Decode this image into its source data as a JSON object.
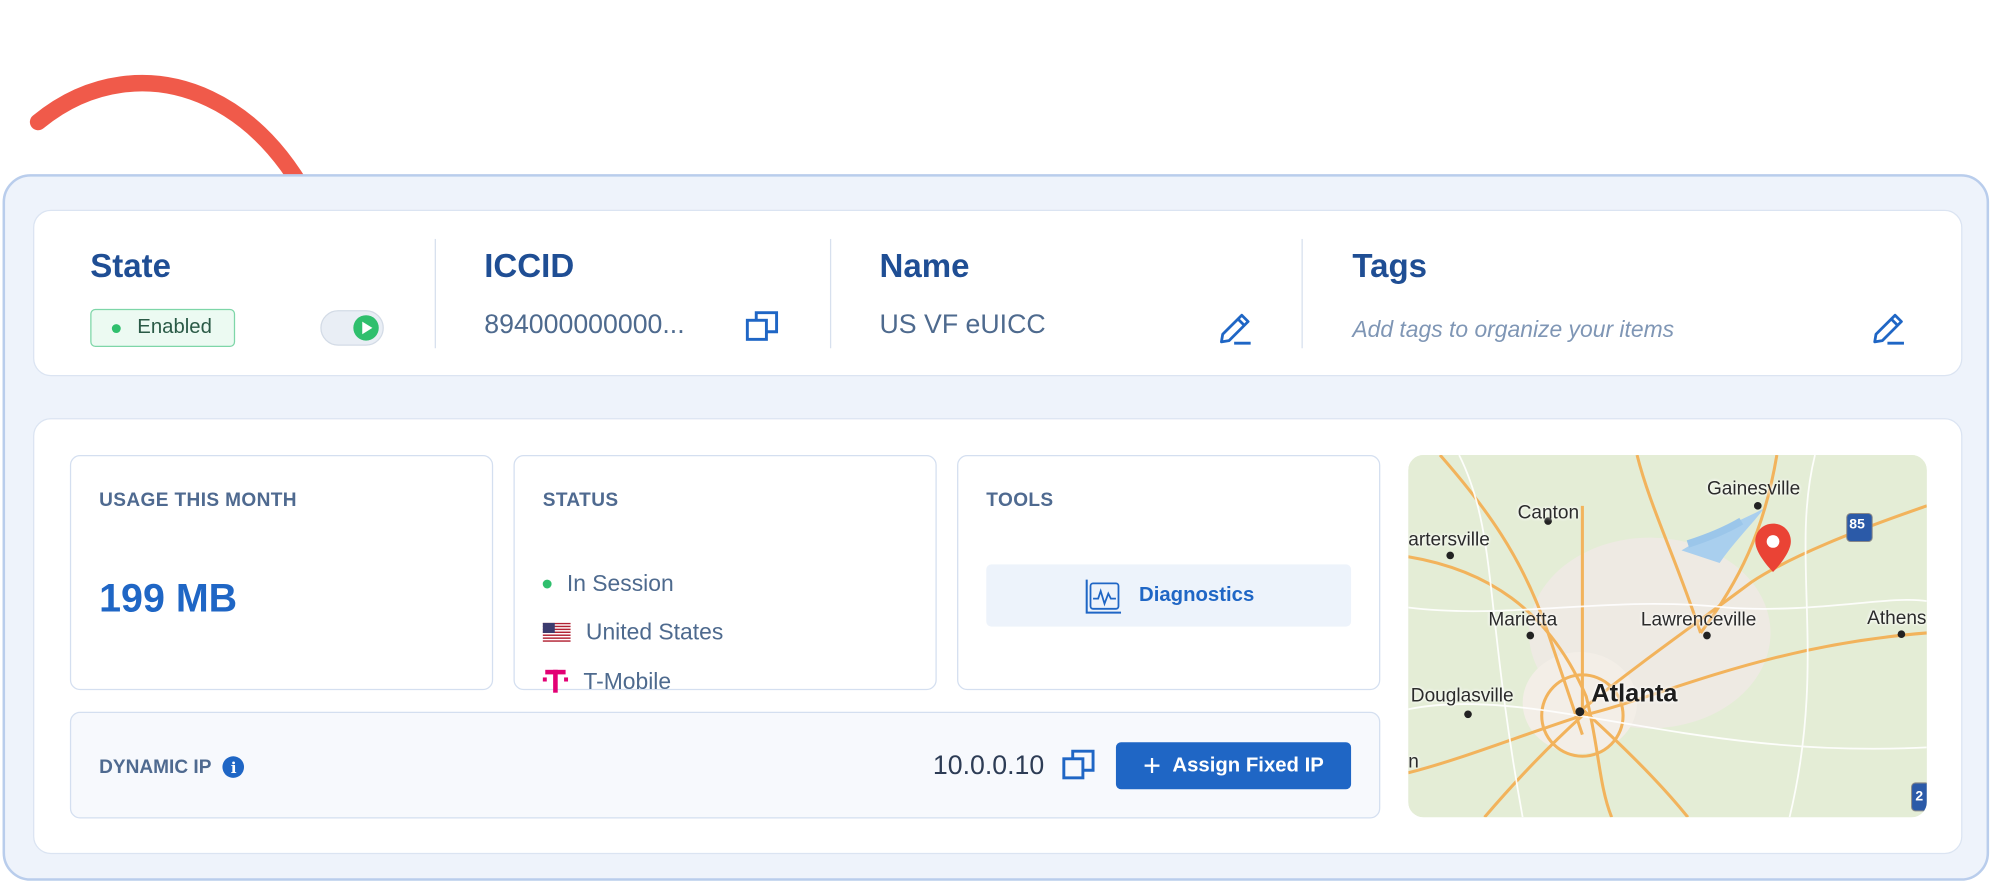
{
  "header": {
    "state": {
      "title": "State",
      "badge": "Enabled"
    },
    "iccid": {
      "title": "ICCID",
      "value": "894000000000..."
    },
    "name": {
      "title": "Name",
      "value": "US VF eUICC"
    },
    "tags": {
      "title": "Tags",
      "placeholder": "Add tags to organize your items"
    }
  },
  "usage": {
    "label": "USAGE THIS MONTH",
    "value": "199 MB"
  },
  "status": {
    "label": "STATUS",
    "session": "In Session",
    "country": "United States",
    "carrier": "T-Mobile"
  },
  "tools": {
    "label": "TOOLS",
    "diagnostics": "Diagnostics"
  },
  "ip": {
    "label": "DYNAMIC IP",
    "info": "i",
    "value": "10.0.0.10",
    "assign_label": "Assign Fixed IP",
    "assign_plus": "+"
  },
  "map": {
    "labels": {
      "gainesville": "Gainesville",
      "canton": "Canton",
      "cartersville": "artersville",
      "marietta": "Marietta",
      "lawrenceville": "Lawrenceville",
      "athens": "Athens",
      "douglasville": "Douglasville",
      "atlanta": "Atlanta",
      "edge_n": "n",
      "interstate": "85",
      "interstate2": "2"
    }
  },
  "colors": {
    "primary": "#1f66c5",
    "heading": "#1f4e94",
    "success": "#2fbf6d",
    "annotation": "#f05a4a",
    "tmobile": "#e20074"
  },
  "icons": [
    "play-icon",
    "copy-icon",
    "edit-icon",
    "diagnostics-icon",
    "info-icon",
    "plus-icon",
    "map-pin-icon",
    "us-flag-icon",
    "tmobile-logo-icon",
    "arrow-annotation"
  ]
}
